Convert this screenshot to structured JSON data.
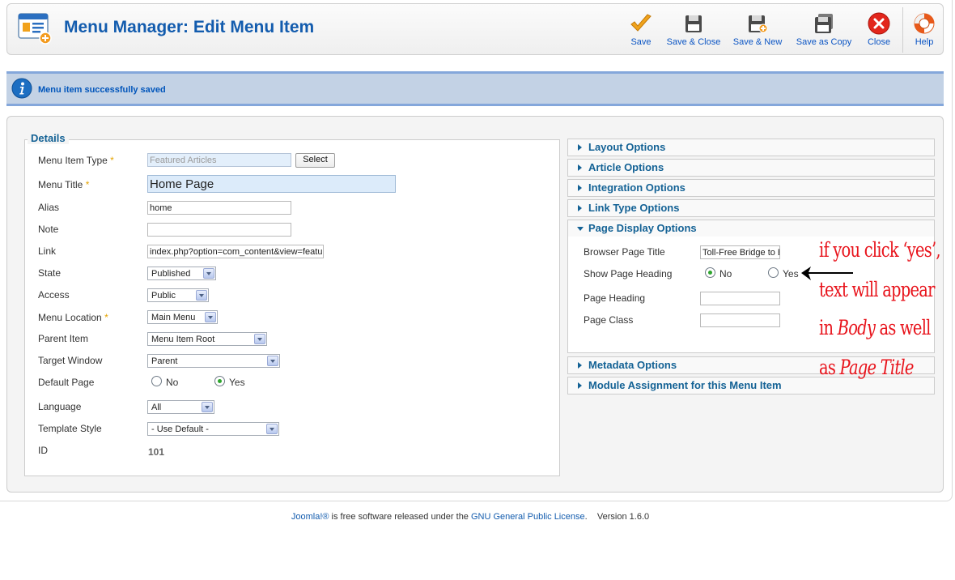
{
  "header": {
    "title": "Menu Manager: Edit Menu Item",
    "icon": "menu-manager-icon"
  },
  "toolbar": {
    "buttons": [
      {
        "label": "Save",
        "icon": "checkmark-icon"
      },
      {
        "label": "Save & Close",
        "icon": "floppy-disk-icon"
      },
      {
        "label": "Save & New",
        "icon": "floppy-disk-plus-icon"
      },
      {
        "label": "Save as Copy",
        "icon": "floppy-disk-copy-icon"
      },
      {
        "label": "Close",
        "icon": "close-circle-icon"
      },
      {
        "label": "Help",
        "icon": "lifebuoy-icon"
      }
    ]
  },
  "message": {
    "text": "Menu item successfully saved",
    "icon": "info-icon"
  },
  "details": {
    "legend": "Details",
    "required_mark": "*",
    "fields": {
      "menu_item_type": {
        "label": "Menu Item Type",
        "value": "Featured Articles",
        "button": "Select"
      },
      "menu_title": {
        "label": "Menu Title",
        "value": "Home Page"
      },
      "alias": {
        "label": "Alias",
        "value": "home"
      },
      "note": {
        "label": "Note",
        "value": ""
      },
      "link": {
        "label": "Link",
        "value": "index.php?option=com_content&view=featured"
      },
      "state": {
        "label": "State",
        "value": "Published"
      },
      "access": {
        "label": "Access",
        "value": "Public"
      },
      "menu_location": {
        "label": "Menu Location",
        "value": "Main Menu"
      },
      "parent_item": {
        "label": "Parent Item",
        "value": "Menu Item Root"
      },
      "target_window": {
        "label": "Target Window",
        "value": "Parent"
      },
      "default_page": {
        "label": "Default Page",
        "option_no": "No",
        "option_yes": "Yes",
        "selected": "Yes"
      },
      "language": {
        "label": "Language",
        "value": "All"
      },
      "template_style": {
        "label": "Template Style",
        "value": "- Use Default -"
      },
      "id": {
        "label": "ID",
        "value": "101"
      }
    }
  },
  "options": {
    "panels": [
      {
        "label": "Layout Options",
        "open": false
      },
      {
        "label": "Article Options",
        "open": false
      },
      {
        "label": "Integration Options",
        "open": false
      },
      {
        "label": "Link Type Options",
        "open": false
      },
      {
        "label": "Page Display Options",
        "open": true
      },
      {
        "label": "Metadata Options",
        "open": false
      },
      {
        "label": "Module Assignment for this Menu Item",
        "open": false
      }
    ],
    "page_display": {
      "browser_page_title": {
        "label": "Browser Page Title",
        "value": "Toll-Free Bridge to England"
      },
      "show_page_heading": {
        "label": "Show Page Heading",
        "option_no": "No",
        "option_yes": "Yes",
        "selected": "No"
      },
      "page_heading": {
        "label": "Page Heading",
        "value": ""
      },
      "page_class": {
        "label": "Page Class",
        "value": ""
      }
    }
  },
  "annotation": {
    "line1": "if you click ‘yes’,",
    "line2": "text will appear",
    "line3_pre": "in ",
    "line3_em": "Body",
    "line3_post": " as well",
    "line4_pre": "as ",
    "line4_em": "Page Title",
    "color": "#e8141c"
  },
  "footer": {
    "joomla_link": "Joomla!®",
    "text1": " is free software released under the ",
    "license_link": "GNU General Public License",
    "text2": ".",
    "version": "Version 1.6.0"
  }
}
